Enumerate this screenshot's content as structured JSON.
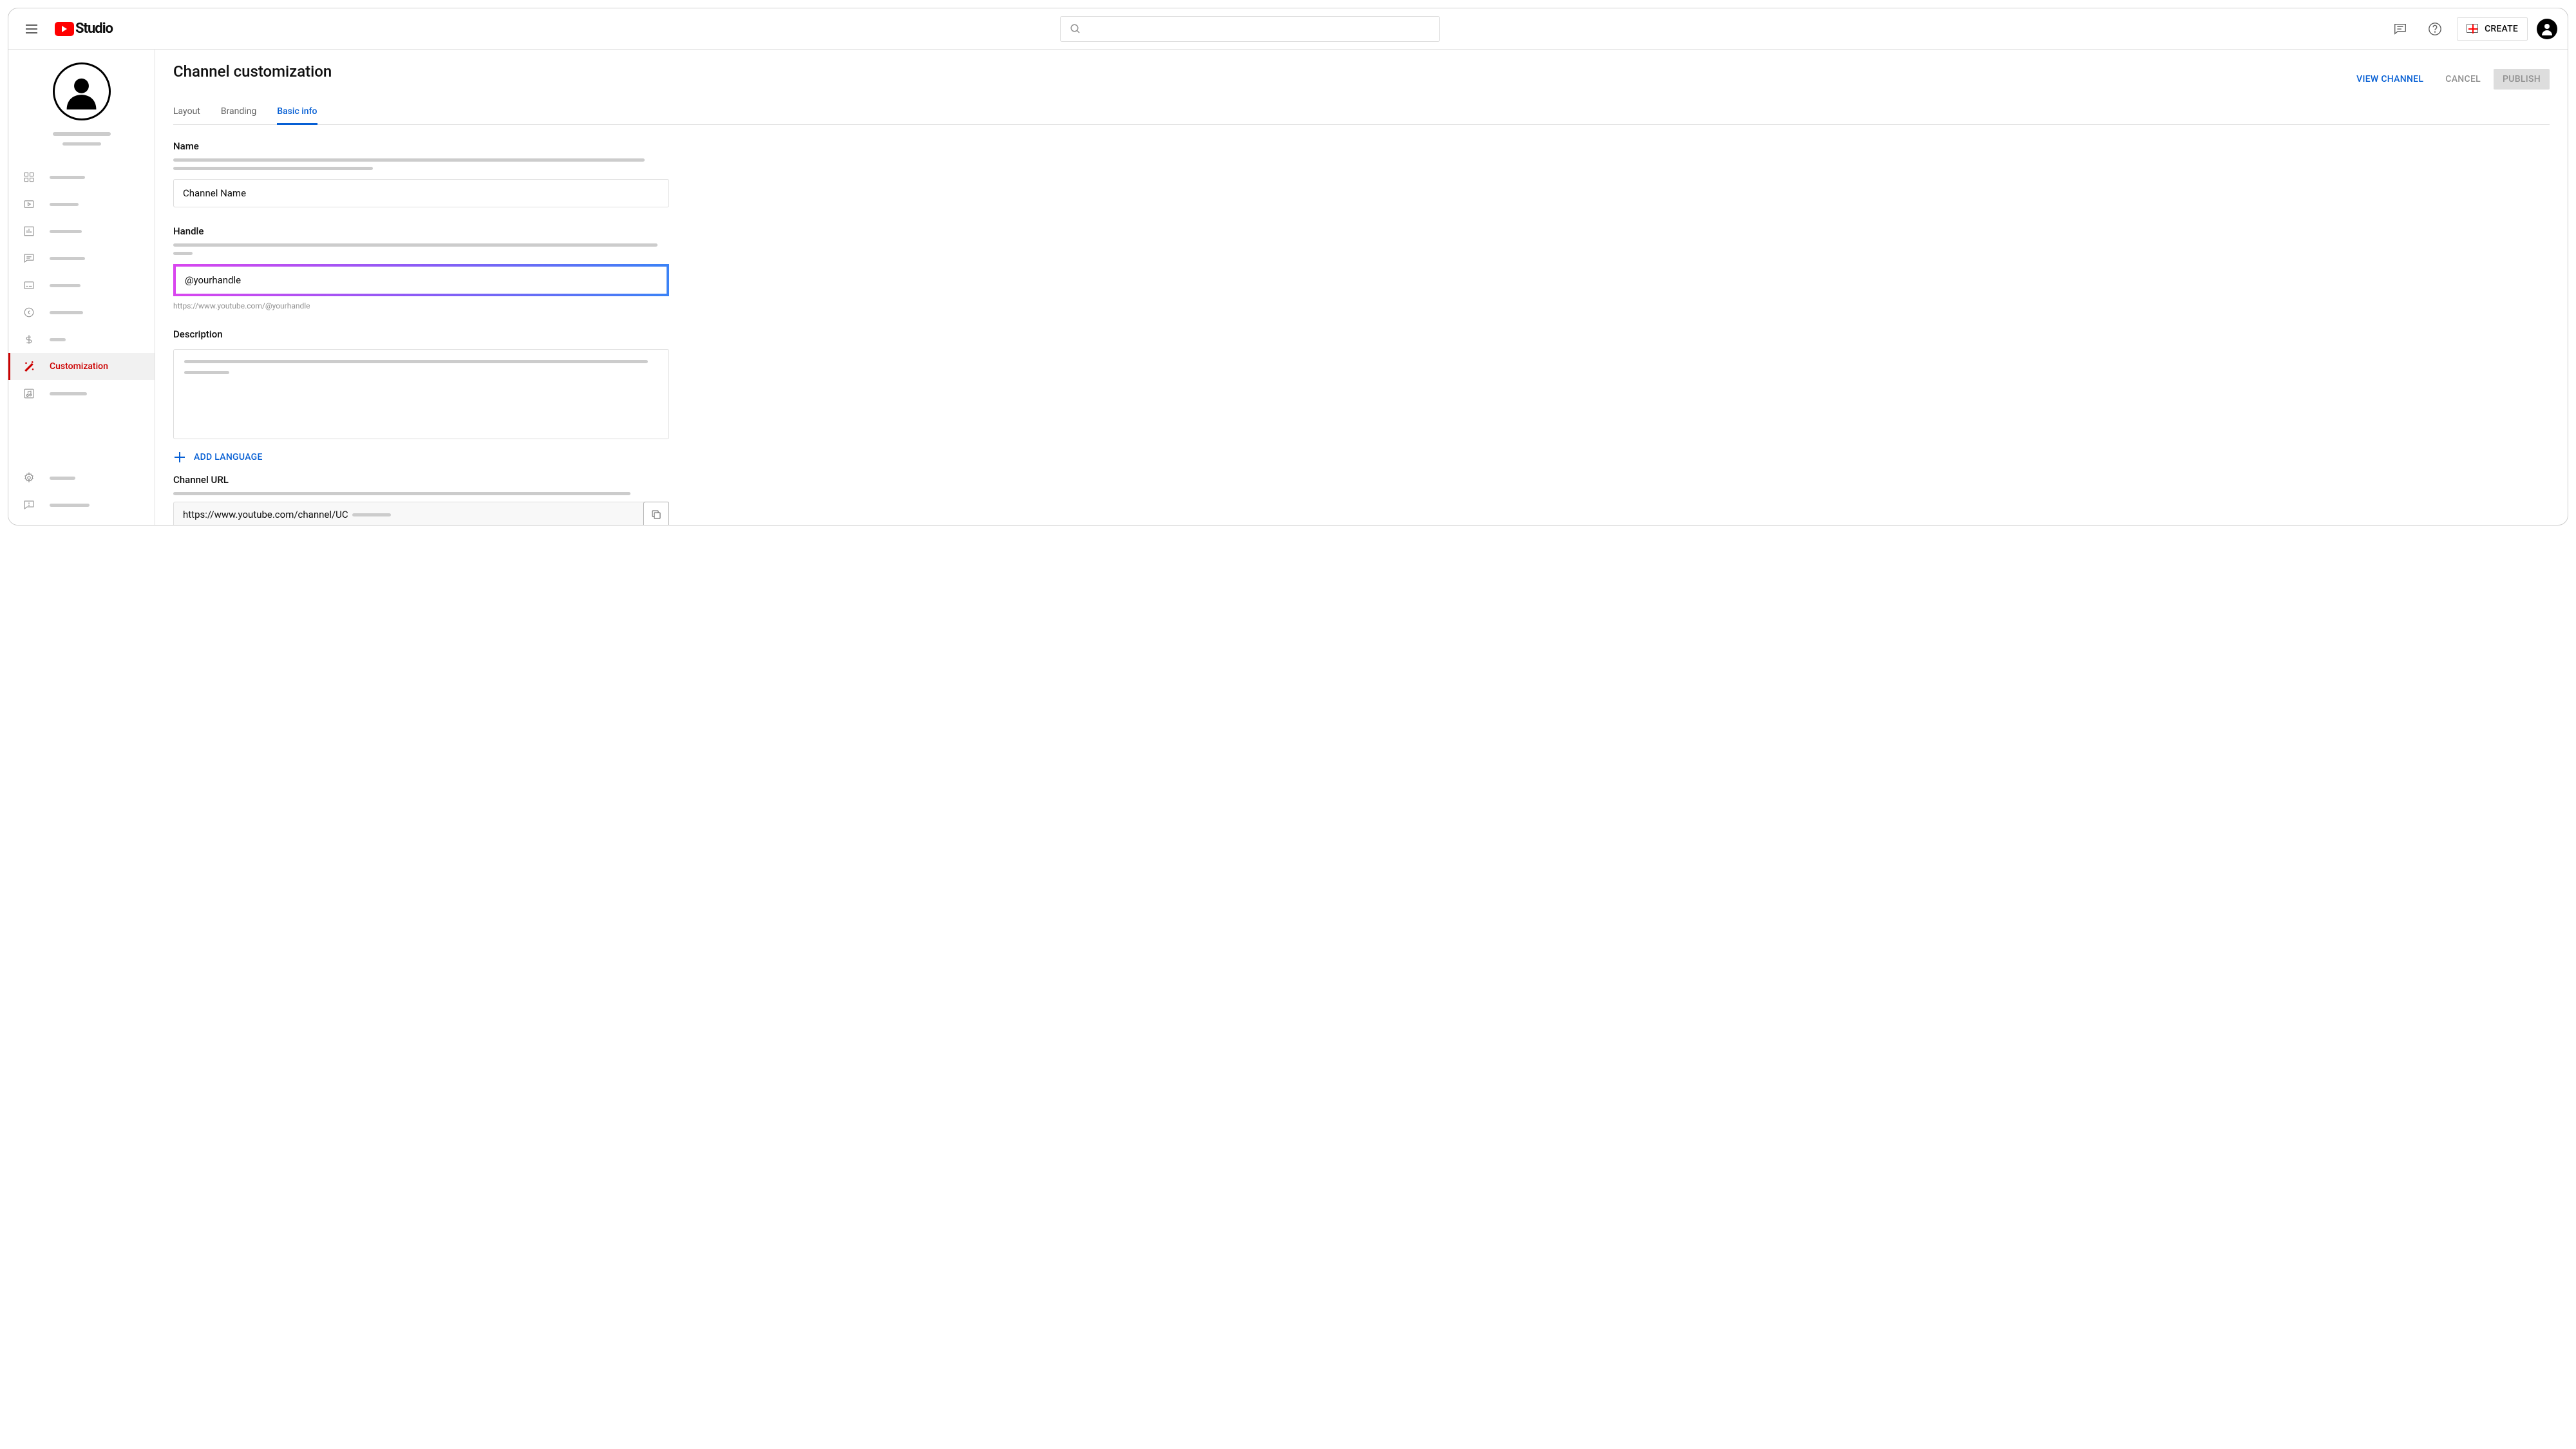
{
  "brand": {
    "studio_label": "Studio"
  },
  "header": {
    "create_label": "CREATE"
  },
  "sidebar": {
    "customization_label": "Customization"
  },
  "page": {
    "title": "Channel customization",
    "view_channel": "VIEW CHANNEL",
    "cancel": "CANCEL",
    "publish": "PUBLISH"
  },
  "tabs": {
    "layout": "Layout",
    "branding": "Branding",
    "basic_info": "Basic info"
  },
  "sections": {
    "name": {
      "label": "Name",
      "value": "Channel Name"
    },
    "handle": {
      "label": "Handle",
      "value": "@yourhandle",
      "helper": "https://www.youtube.com/@yourhandle"
    },
    "description": {
      "label": "Description",
      "add_language": "ADD LANGUAGE"
    },
    "channel_url": {
      "label": "Channel URL",
      "value": "https://www.youtube.com/channel/UC"
    }
  }
}
